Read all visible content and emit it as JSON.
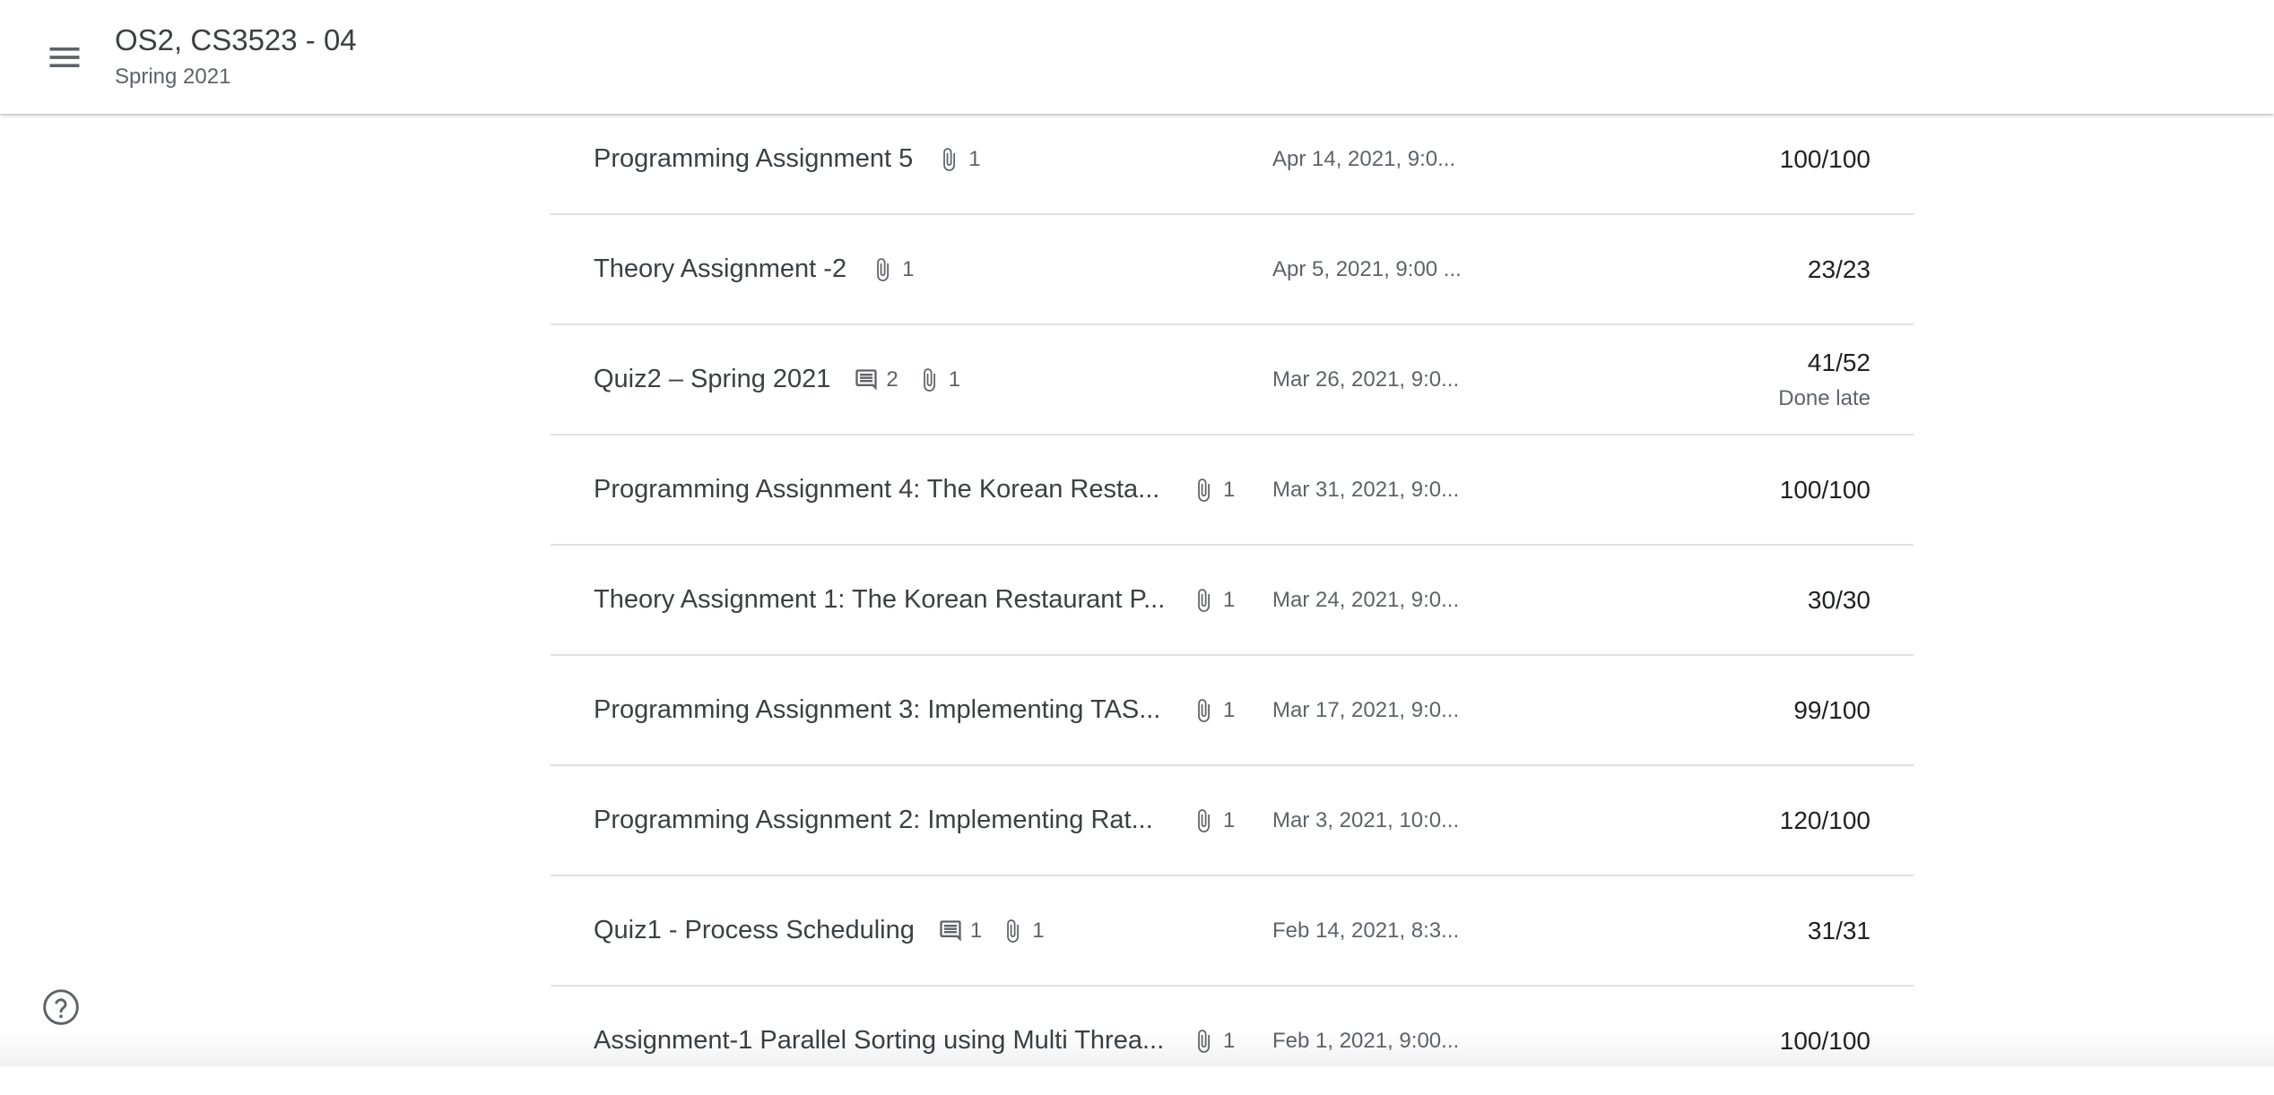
{
  "header": {
    "title": "OS2, CS3523 - 04",
    "subtitle": "Spring 2021",
    "menu_icon": "hamburger-menu-icon"
  },
  "assignments": [
    {
      "title": "Programming Assignment 5",
      "comments": null,
      "attachments": "1",
      "date": "Apr 14, 2021, 9:0...",
      "grade": "100/100",
      "note": null
    },
    {
      "title": "Theory Assignment -2",
      "comments": null,
      "attachments": "1",
      "date": "Apr 5, 2021, 9:00 ...",
      "grade": "23/23",
      "note": null
    },
    {
      "title": "Quiz2 – Spring 2021",
      "comments": "2",
      "attachments": "1",
      "date": "Mar 26, 2021, 9:0...",
      "grade": "41/52",
      "note": "Done late"
    },
    {
      "title": "Programming Assignment 4: The Korean Resta...",
      "comments": null,
      "attachments": "1",
      "date": "Mar 31, 2021, 9:0...",
      "grade": "100/100",
      "note": null
    },
    {
      "title": "Theory Assignment 1: The Korean Restaurant P...",
      "comments": null,
      "attachments": "1",
      "date": "Mar 24, 2021, 9:0...",
      "grade": "30/30",
      "note": null
    },
    {
      "title": "Programming Assignment 3: Implementing TAS...",
      "comments": null,
      "attachments": "1",
      "date": "Mar 17, 2021, 9:0...",
      "grade": "99/100",
      "note": null
    },
    {
      "title": "Programming Assignment 2: Implementing Rat...",
      "comments": null,
      "attachments": "1",
      "date": "Mar 3, 2021, 10:0...",
      "grade": "120/100",
      "note": null
    },
    {
      "title": "Quiz1 - Process Scheduling",
      "comments": "1",
      "attachments": "1",
      "date": "Feb 14, 2021, 8:3...",
      "grade": "31/31",
      "note": null
    },
    {
      "title": "Assignment-1 Parallel Sorting using Multi Threa...",
      "comments": null,
      "attachments": "1",
      "date": "Feb 1, 2021, 9:00...",
      "grade": "100/100",
      "note": null
    }
  ],
  "help_icon": "help-circle-icon"
}
